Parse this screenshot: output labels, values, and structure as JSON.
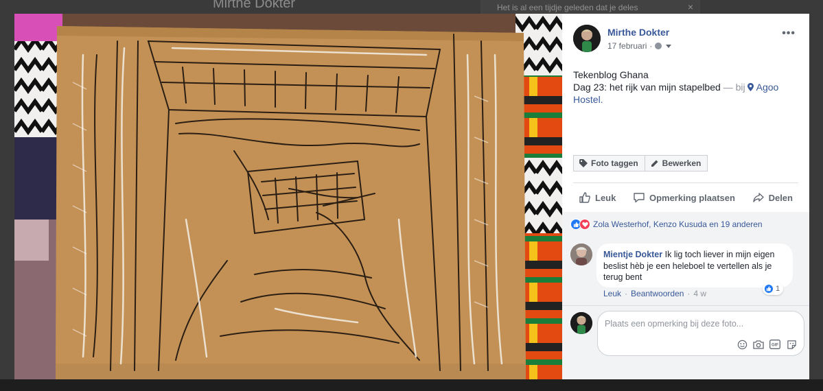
{
  "background": {
    "title": "Mirthe Dokter",
    "notice": "Het is al een tijdje geleden dat je deles",
    "notice_close": "×"
  },
  "post": {
    "author": "Mirthe Dokter",
    "date": "17 februari",
    "date_separator": "·",
    "more_label": "•••",
    "caption_line1": "Tekenblog Ghana",
    "caption_line2": "Dag 23: het rijk van mijn stapelbed",
    "location_separator": "— bij",
    "location": "Agoo Hostel.",
    "photo_alt": "Drawing of a bunk bed on brown paper"
  },
  "photo_actions": {
    "tag": "Foto taggen",
    "edit": "Bewerken"
  },
  "actions": {
    "like": "Leuk",
    "comment": "Opmerking plaatsen",
    "share": "Delen"
  },
  "reactions": {
    "summary": "Zola Westerhof, Kenzo Kusuda en 19 anderen",
    "icons": [
      "like-icon",
      "love-icon"
    ]
  },
  "comments": [
    {
      "author": "Mientje Dokter",
      "text": "Ik lig toch liever in mijn eigen beslist hèb je een heleboel te vertellen als je terug bent",
      "like_action": "Leuk",
      "reply_action": "Beantwoorden",
      "separator": "·",
      "age": "4 w",
      "like_count": "1"
    }
  ],
  "composer": {
    "placeholder": "Plaats een opmerking bij deze foto...",
    "tools": [
      "emoji-icon",
      "camera-icon",
      "gif-icon",
      "sticker-icon"
    ],
    "gif_label": "GIF"
  },
  "colors": {
    "link": "#385898",
    "muted": "#616770",
    "like_blue": "#2078f4",
    "love_red": "#f33e58"
  }
}
